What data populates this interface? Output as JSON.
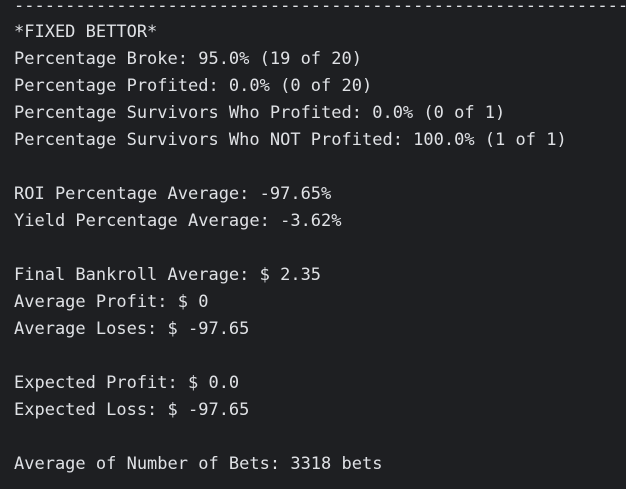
{
  "terminal": {
    "divider": "-----------------------------------------------------------------------",
    "lines": [
      "*FIXED BETTOR*",
      "Percentage Broke: 95.0% (19 of 20)",
      "Percentage Profited: 0.0% (0 of 20)",
      "Percentage Survivors Who Profited: 0.0% (0 of 1)",
      "Percentage Survivors Who NOT Profited: 100.0% (1 of 1)",
      "",
      "ROI Percentage Average: -97.65%",
      "Yield Percentage Average: -3.62%",
      "",
      "Final Bankroll Average: $ 2.35",
      "Average Profit: $ 0",
      "Average Loses: $ -97.65",
      "",
      "Expected Profit: $ 0.0",
      "Expected Loss: $ -97.65",
      "",
      "Average of Number of Bets: 3318 bets"
    ]
  }
}
